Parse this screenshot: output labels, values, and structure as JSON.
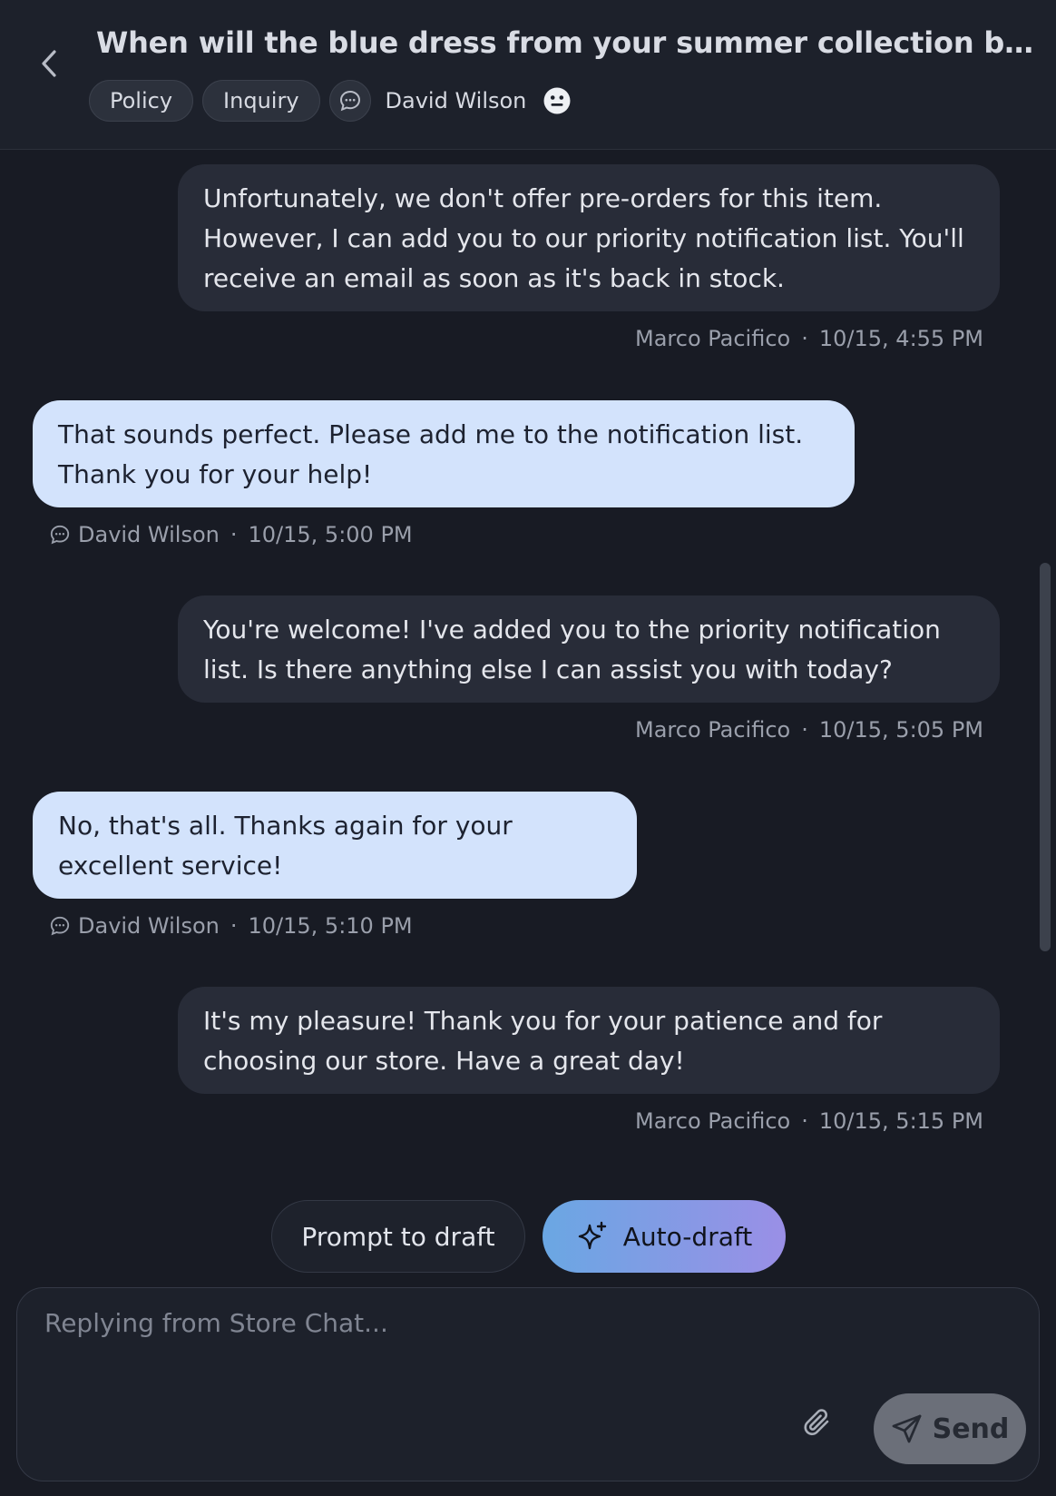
{
  "header": {
    "title": "When will the blue dress from your summer collection be back i…",
    "tags": [
      "Policy",
      "Inquiry"
    ],
    "customer_name": "David Wilson"
  },
  "messages": [
    {
      "role": "agent",
      "text": "Unfortunately, we don't offer pre-orders for this item. However, I can add you to our priority notification list. You'll receive an email as soon as it's back in stock.",
      "author": "Marco Pacifico",
      "time": "10/15, 4:55 PM"
    },
    {
      "role": "customer",
      "text": "That sounds perfect. Please add me to the notification list. Thank you for your help!",
      "author": "David Wilson",
      "time": "10/15, 5:00 PM"
    },
    {
      "role": "agent",
      "text": "You're welcome! I've added you to the priority notification list. Is there anything else I can assist you with today?",
      "author": "Marco Pacifico",
      "time": "10/15, 5:05 PM"
    },
    {
      "role": "customer",
      "text": "No, that's all. Thanks again for your excellent service!",
      "author": "David Wilson",
      "time": "10/15, 5:10 PM"
    },
    {
      "role": "agent",
      "text": "It's my pleasure! Thank you for your patience and for choosing our store. Have a great day!",
      "author": "Marco Pacifico",
      "time": "10/15, 5:15 PM"
    }
  ],
  "draft": {
    "prompt_label": "Prompt to draft",
    "auto_label": "Auto-draft"
  },
  "composer": {
    "placeholder": "Replying from Store Chat...",
    "value": "",
    "send_label": "Send"
  },
  "icons": {
    "back": "chevron-left-icon",
    "channel": "chat-bubble-icon",
    "sentiment": "neutral-face-icon",
    "sparkle": "sparkle-icon",
    "attach": "paperclip-icon",
    "send": "send-icon"
  },
  "colors": {
    "background": "#181b24",
    "agent_bubble": "#282c38",
    "customer_bubble": "#d3e3fc",
    "auto_draft_gradient_start": "#6aa7e3",
    "auto_draft_gradient_end": "#9a8fe6"
  }
}
